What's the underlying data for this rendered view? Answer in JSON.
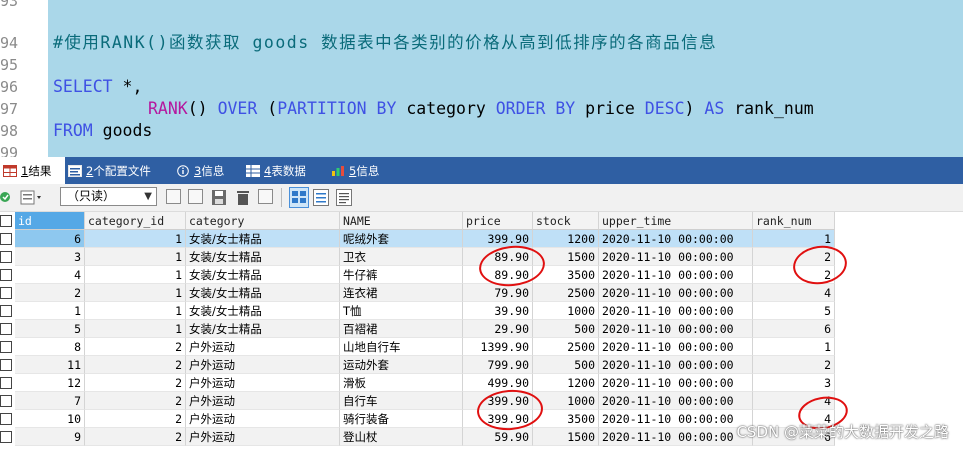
{
  "editor": {
    "line_numbers": [
      "93",
      "94",
      "95",
      "96",
      "97",
      "98",
      "99"
    ],
    "comment": "#使用RANK()函数获取 goods 数据表中各类别的价格从高到低排序的各商品信息",
    "line_select": {
      "kw": "SELECT",
      "rest": " *,"
    },
    "line_rank": {
      "fn": "RANK",
      "paren": "() ",
      "over": "OVER",
      "open": " (",
      "partition": "PARTITION BY",
      "category": " category ",
      "order": "ORDER BY",
      "price": " price ",
      "desc": "DESC",
      "close": ") ",
      "as": "AS",
      "alias": " rank_num"
    },
    "line_from": {
      "kw": "FROM",
      "rest": " goods"
    }
  },
  "tabs": [
    {
      "num": "1",
      "label": " 结果",
      "icon": "table-icon",
      "active": true
    },
    {
      "num": "2",
      "label": " 个配置文件",
      "icon": "profile-icon",
      "active": false
    },
    {
      "num": "3",
      "label": " 信息",
      "icon": "info-icon",
      "active": false
    },
    {
      "num": "4",
      "label": " 表数据",
      "icon": "table-data-icon",
      "active": false
    },
    {
      "num": "5",
      "label": " 信息",
      "icon": "info-icon",
      "active": false
    }
  ],
  "toolbar": {
    "mode_select": "（只读）"
  },
  "columns": [
    "id",
    "category_id",
    "category",
    "NAME",
    "price",
    "stock",
    "upper_time",
    "rank_num"
  ],
  "rows": [
    [
      "6",
      "1",
      "女装/女士精品",
      "呢绒外套",
      "399.90",
      "1200",
      "2020-11-10 00:00:00",
      "1"
    ],
    [
      "3",
      "1",
      "女装/女士精品",
      "卫衣",
      "89.90",
      "1500",
      "2020-11-10 00:00:00",
      "2"
    ],
    [
      "4",
      "1",
      "女装/女士精品",
      "牛仔裤",
      "89.90",
      "3500",
      "2020-11-10 00:00:00",
      "2"
    ],
    [
      "2",
      "1",
      "女装/女士精品",
      "连衣裙",
      "79.90",
      "2500",
      "2020-11-10 00:00:00",
      "4"
    ],
    [
      "1",
      "1",
      "女装/女士精品",
      "T恤",
      "39.90",
      "1000",
      "2020-11-10 00:00:00",
      "5"
    ],
    [
      "5",
      "1",
      "女装/女士精品",
      "百褶裙",
      "29.90",
      "500",
      "2020-11-10 00:00:00",
      "6"
    ],
    [
      "8",
      "2",
      "户外运动",
      "山地自行车",
      "1399.90",
      "2500",
      "2020-11-10 00:00:00",
      "1"
    ],
    [
      "11",
      "2",
      "户外运动",
      "运动外套",
      "799.90",
      "500",
      "2020-11-10 00:00:00",
      "2"
    ],
    [
      "12",
      "2",
      "户外运动",
      "滑板",
      "499.90",
      "1200",
      "2020-11-10 00:00:00",
      "3"
    ],
    [
      "7",
      "2",
      "户外运动",
      "自行车",
      "399.90",
      "1000",
      "2020-11-10 00:00:00",
      "4"
    ],
    [
      "10",
      "2",
      "户外运动",
      "骑行装备",
      "399.90",
      "3500",
      "2020-11-10 00:00:00",
      "4"
    ],
    [
      "9",
      "2",
      "户外运动",
      "登山杖",
      "59.90",
      "1500",
      "2020-11-10 00:00:00",
      "6"
    ]
  ],
  "watermark": "CSDN @菜菜的大数据开发之路",
  "colors": {
    "editor_bg": "#aad7e9",
    "tab_bar": "#2f5fa3",
    "annotation": "#e01010"
  }
}
